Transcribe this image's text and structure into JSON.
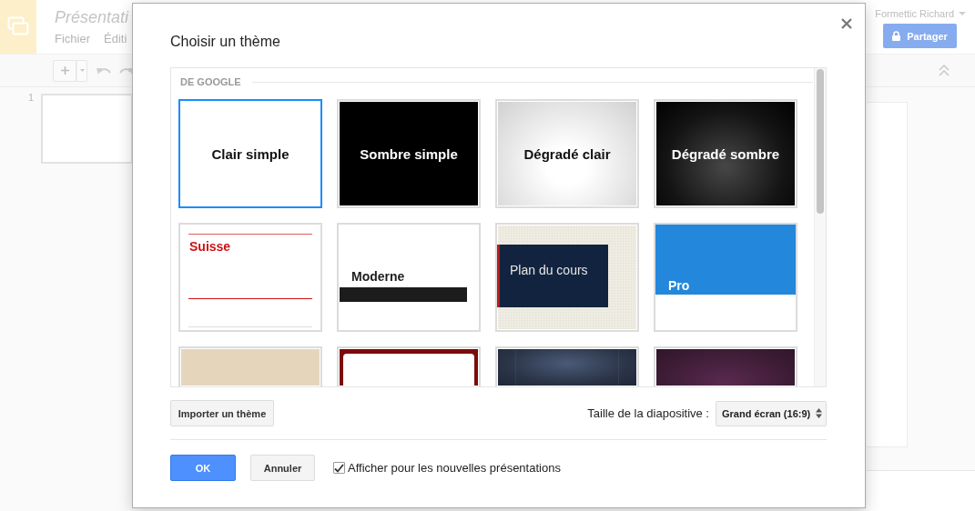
{
  "app": {
    "title": "Présentati",
    "menu": [
      "Fichier",
      "Éditi"
    ],
    "user": "Formettic Richard",
    "share_button": "Partager",
    "slides": [
      {
        "number": "1"
      }
    ]
  },
  "dialog": {
    "title": "Choisir un thème",
    "section": "DE GOOGLE",
    "themes": [
      {
        "kind": "light",
        "name": "Clair simple",
        "selected": true
      },
      {
        "kind": "dark",
        "name": "Sombre simple",
        "selected": false
      },
      {
        "kind": "lightgradient",
        "name": "Dégradé clair",
        "selected": false
      },
      {
        "kind": "darkgradient",
        "name": "Dégradé sombre",
        "selected": false
      },
      {
        "kind": "swiss",
        "name": "Suisse",
        "selected": false
      },
      {
        "kind": "modern",
        "name": "Moderne",
        "selected": false
      },
      {
        "kind": "outline",
        "name": "Plan du cours",
        "selected": false
      },
      {
        "kind": "pro",
        "name": "Pro",
        "selected": false
      },
      {
        "kind": "sand",
        "selected": false
      },
      {
        "kind": "frame",
        "selected": false
      },
      {
        "kind": "stage",
        "selected": false
      },
      {
        "kind": "plum",
        "selected": false
      }
    ],
    "import_button": "Importer un thème",
    "slide_size": {
      "label": "Taille de la diapositive :",
      "value": "Grand écran (16:9)"
    },
    "ok_button": "OK",
    "cancel_button": "Annuler",
    "show_for_new": {
      "label": "Afficher pour les nouvelles présentations",
      "checked": true
    }
  }
}
